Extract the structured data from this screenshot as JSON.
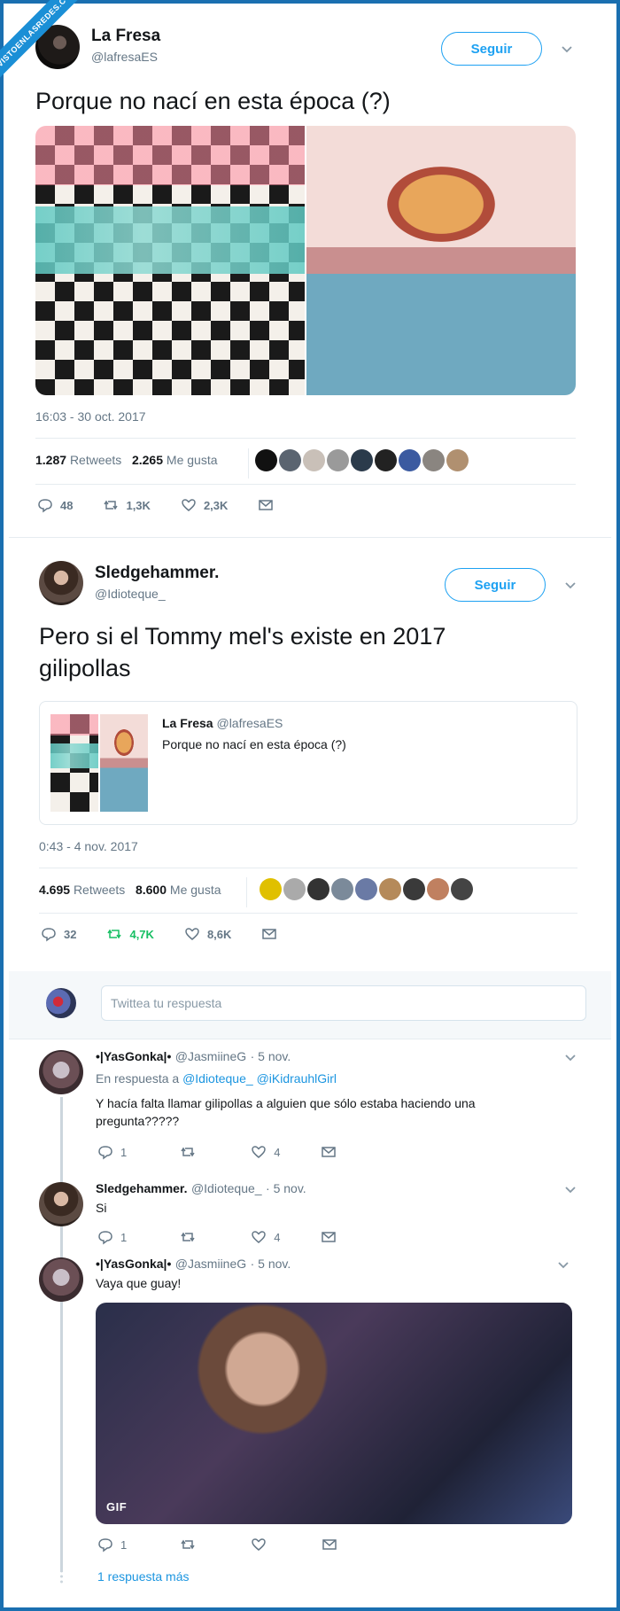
{
  "watermark": "VISTOENLASREDES.COM",
  "tweet1": {
    "name": "La Fresa",
    "handle": "@lafresaES",
    "follow": "Seguir",
    "text": "Porque no nací en esta época (?)",
    "timestamp": "16:03 - 30 oct. 2017",
    "retweets_count": "1.287",
    "retweets_label": "Retweets",
    "likes_count": "2.265",
    "likes_label": "Me gusta",
    "replies": "48",
    "rts": "1,3K",
    "likes": "2,3K"
  },
  "tweet2": {
    "name": "Sledgehammer.",
    "handle": "@Idioteque_",
    "follow": "Seguir",
    "text": "Pero si el Tommy mel's existe en 2017 gilipollas",
    "quote_name": "La Fresa",
    "quote_handle": "@lafresaES",
    "quote_text": "Porque no nací en esta época (?)",
    "timestamp": "0:43 - 4 nov. 2017",
    "retweets_count": "4.695",
    "retweets_label": "Retweets",
    "likes_count": "8.600",
    "likes_label": "Me gusta",
    "replies": "32",
    "rts": "4,7K",
    "likes": "8,6K"
  },
  "reply_box": {
    "placeholder": "Twittea tu respuesta"
  },
  "reply1": {
    "name": "•|YasGonka|•",
    "handle": "@JasmiineG",
    "time": "· 5 nov.",
    "in_reply_prefix": "En respuesta a",
    "mention1": "@Idioteque_",
    "mention2": "@iKidrauhlGirl",
    "text": "Y hacía falta llamar gilipollas a alguien que sólo estaba haciendo una pregunta?????",
    "replies": "1",
    "likes": "4"
  },
  "reply2": {
    "name": "Sledgehammer.",
    "handle": "@Idioteque_",
    "time": "· 5 nov.",
    "text": "Si",
    "replies": "1",
    "likes": "4"
  },
  "reply3": {
    "name": "•|YasGonka|•",
    "handle": "@JasmiineG",
    "time": "· 5 nov.",
    "text": "Vaya que guay!",
    "gif_label": "GIF",
    "replies": "1"
  },
  "more_replies": "1 respuesta más",
  "colors": {
    "accent": "#1da1f2",
    "retweet_green": "#17bf63",
    "frame": "#1a6fb0"
  }
}
